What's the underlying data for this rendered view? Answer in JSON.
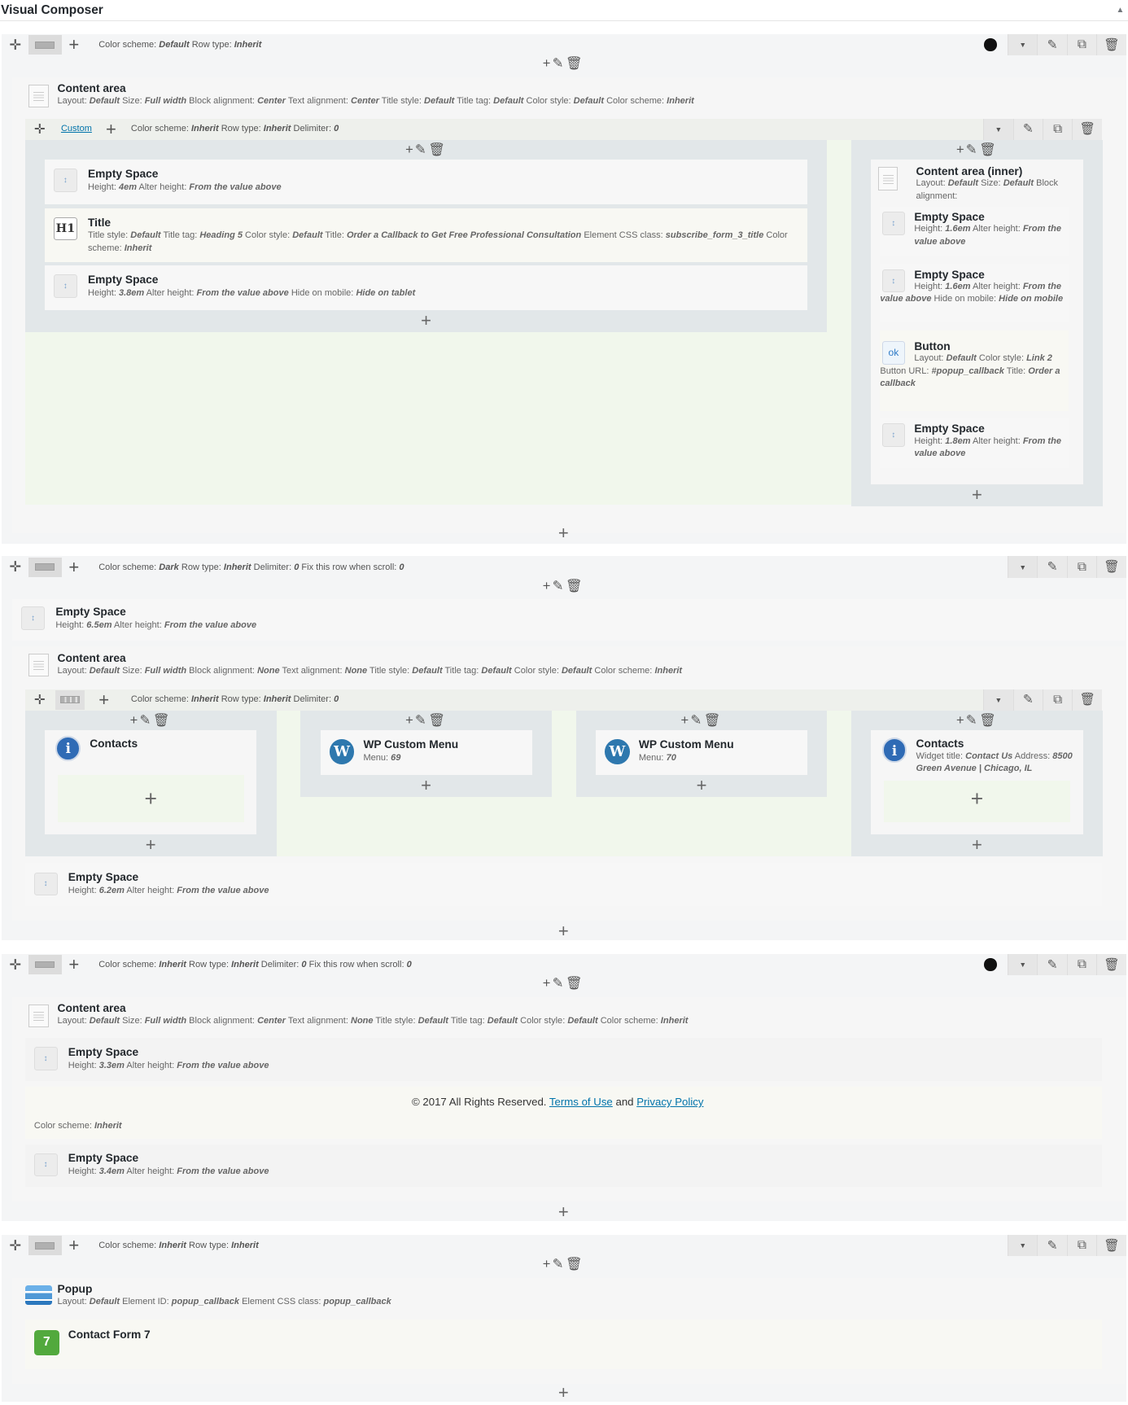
{
  "header": {
    "title": "Visual Composer",
    "collapse_icon": "triangle-up-icon"
  },
  "row1": {
    "params": [
      [
        "Color scheme:",
        "Default"
      ],
      [
        "Row type:",
        "Inherit"
      ]
    ],
    "content_area": {
      "name": "Content area",
      "params": [
        [
          "Layout:",
          "Default"
        ],
        [
          "Size:",
          "Full width"
        ],
        [
          "Block alignment:",
          "Center"
        ],
        [
          "Text alignment:",
          "Center"
        ],
        [
          "Title style:",
          "Default"
        ],
        [
          "Title tag:",
          "Default"
        ],
        [
          "Color style:",
          "Default"
        ],
        [
          "Color scheme:",
          "Inherit"
        ]
      ]
    },
    "inner_row": {
      "layout_label": "Custom",
      "params": [
        [
          "Color scheme:",
          "Inherit"
        ],
        [
          "Row type:",
          "Inherit"
        ],
        [
          "Delimiter:",
          "0"
        ]
      ]
    },
    "left_col": [
      {
        "name": "Empty Space",
        "params": [
          [
            "Height:",
            "4em"
          ],
          [
            "Alter height:",
            "From the value above"
          ]
        ]
      },
      {
        "name": "Title",
        "icon": "H1",
        "params": [
          [
            "Title style:",
            "Default"
          ],
          [
            "Title tag:",
            "Heading 5"
          ],
          [
            "Color style:",
            "Default"
          ],
          [
            "Title:",
            "Order a Callback to Get Free Professional Consultation"
          ],
          [
            "Element CSS class:",
            "subscribe_form_3_title"
          ],
          [
            "Color scheme:",
            "Inherit"
          ]
        ]
      },
      {
        "name": "Empty Space",
        "params": [
          [
            "Height:",
            "3.8em"
          ],
          [
            "Alter height:",
            "From the value above"
          ],
          [
            "Hide on mobile:",
            "Hide on tablet"
          ]
        ]
      }
    ],
    "right_col": {
      "inner_area": {
        "name": "Content area (inner)",
        "params": [
          [
            "Layout:",
            "Default"
          ],
          [
            "Size:",
            "Default"
          ],
          [
            "Block alignment:",
            ""
          ]
        ]
      },
      "items": [
        {
          "name": "Empty Space",
          "params": [
            [
              "Height:",
              "1.6em"
            ],
            [
              "Alter height:",
              "From the value above"
            ]
          ]
        },
        {
          "name": "Empty Space",
          "params": [
            [
              "Height:",
              "1.6em"
            ],
            [
              "Alter height:",
              "From the value above"
            ],
            [
              "Hide on mobile:",
              "Hide on mobile"
            ]
          ]
        },
        {
          "name": "Button",
          "icon": "ok",
          "params": [
            [
              "Layout:",
              "Default"
            ],
            [
              "Color style:",
              "Link 2"
            ],
            [
              "Button URL:",
              "#popup_callback"
            ],
            [
              "Title:",
              "Order a callback"
            ]
          ]
        },
        {
          "name": "Empty Space",
          "params": [
            [
              "Height:",
              "1.8em"
            ],
            [
              "Alter height:",
              "From the value above"
            ]
          ]
        }
      ]
    }
  },
  "row2": {
    "params": [
      [
        "Color scheme:",
        "Dark"
      ],
      [
        "Row type:",
        "Inherit"
      ],
      [
        "Delimiter:",
        "0"
      ],
      [
        "Fix this row when scroll:",
        "0"
      ]
    ],
    "empty_space": {
      "name": "Empty Space",
      "params": [
        [
          "Height:",
          "6.5em"
        ],
        [
          "Alter height:",
          "From the value above"
        ]
      ]
    },
    "content_area": {
      "name": "Content area",
      "params": [
        [
          "Layout:",
          "Default"
        ],
        [
          "Size:",
          "Full width"
        ],
        [
          "Block alignment:",
          "None"
        ],
        [
          "Text alignment:",
          "None"
        ],
        [
          "Title style:",
          "Default"
        ],
        [
          "Title tag:",
          "Default"
        ],
        [
          "Color style:",
          "Default"
        ],
        [
          "Color scheme:",
          "Inherit"
        ]
      ]
    },
    "inner_row": {
      "params": [
        [
          "Color scheme:",
          "Inherit"
        ],
        [
          "Row type:",
          "Inherit"
        ],
        [
          "Delimiter:",
          "0"
        ]
      ]
    },
    "cols": [
      {
        "name": "Contacts",
        "icon": "i",
        "params": []
      },
      {
        "name": "WP Custom Menu",
        "icon": "W",
        "params": [
          [
            "Menu:",
            "69"
          ]
        ]
      },
      {
        "name": "WP Custom Menu",
        "icon": "W",
        "params": [
          [
            "Menu:",
            "70"
          ]
        ]
      },
      {
        "name": "Contacts",
        "icon": "i",
        "params": [
          [
            "Widget title:",
            "Contact Us"
          ],
          [
            "Address:",
            "8500 Green Avenue | Chicago, IL"
          ]
        ]
      }
    ],
    "empty_space_bottom": {
      "name": "Empty Space",
      "params": [
        [
          "Height:",
          "6.2em"
        ],
        [
          "Alter height:",
          "From the value above"
        ]
      ]
    }
  },
  "row3": {
    "params": [
      [
        "Color scheme:",
        "Inherit"
      ],
      [
        "Row type:",
        "Inherit"
      ],
      [
        "Delimiter:",
        "0"
      ],
      [
        "Fix this row when scroll:",
        "0"
      ]
    ],
    "content_area": {
      "name": "Content area",
      "params": [
        [
          "Layout:",
          "Default"
        ],
        [
          "Size:",
          "Full width"
        ],
        [
          "Block alignment:",
          "Center"
        ],
        [
          "Text alignment:",
          "None"
        ],
        [
          "Title style:",
          "Default"
        ],
        [
          "Title tag:",
          "Default"
        ],
        [
          "Color style:",
          "Default"
        ],
        [
          "Color scheme:",
          "Inherit"
        ]
      ]
    },
    "empty_top": {
      "name": "Empty Space",
      "params": [
        [
          "Height:",
          "3.3em"
        ],
        [
          "Alter height:",
          "From the value above"
        ]
      ]
    },
    "footer": {
      "text_before": "© 2017 All Rights Reserved. ",
      "terms": "Terms of Use",
      "and": " and ",
      "privacy": "Privacy Policy",
      "scheme_label": "Color scheme:",
      "scheme_value": "Inherit"
    },
    "empty_bottom": {
      "name": "Empty Space",
      "params": [
        [
          "Height:",
          "3.4em"
        ],
        [
          "Alter height:",
          "From the value above"
        ]
      ]
    }
  },
  "row4": {
    "params": [
      [
        "Color scheme:",
        "Inherit"
      ],
      [
        "Row type:",
        "Inherit"
      ]
    ],
    "popup": {
      "name": "Popup",
      "params": [
        [
          "Layout:",
          "Default"
        ],
        [
          "Element ID:",
          "popup_callback"
        ],
        [
          "Element CSS class:",
          "popup_callback"
        ]
      ]
    },
    "cf7": {
      "name": "Contact Form 7",
      "icon": "7"
    }
  },
  "controls": {
    "add": "+",
    "edit": "✎",
    "delete": "🗑",
    "copy": "⧉",
    "chevron": "▾",
    "move": "✛"
  }
}
